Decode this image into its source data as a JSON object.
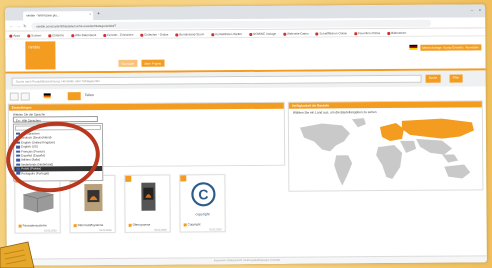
{
  "colors": {
    "accent": "#f39c1f",
    "annotation": "#b7371f",
    "background": "#f4cf7c"
  },
  "browser": {
    "tab_title": "nimble - Wohnzone plu...",
    "tab_close": "×",
    "new_tab": "+",
    "minimize": "–",
    "close": "×",
    "url": "nimble.com/content/bauteile/suche-erweitert/kategorie/bild/7",
    "back": "←",
    "forward": "→",
    "reload": "↻",
    "bookmarks": [
      "Apps",
      "Suchen",
      "Einfache",
      "Wiki-Datenbank",
      "Fenster - Einrichten",
      "Einfacher - Online",
      "Bundesland-Sturm",
      "Kontaktlisten Wetter",
      "NOMINE Vorlage",
      "Webseite-Daten",
      "Schaltflächen Online",
      "Favoriten-Online",
      "Bildmarken"
    ]
  },
  "app": {
    "logo": "nimble",
    "top_buttons": [
      "Meine Anfragen",
      "Konto-Einstellungen",
      "Abmelden"
    ],
    "nav_tabs": [
      "Startseite",
      "Mein Projekt"
    ],
    "search_placeholder": "Suche nach Produktbezeichnung, Hersteller oder Schlagworten",
    "search_button": "Suche",
    "filter_button": "Filter",
    "share_label": "Teilen",
    "left_panel_title": "Einstellungen",
    "select_label": "Wählen Sie die Sprache",
    "select_value": "En - Alle Sprachen",
    "dropdown_items": [
      "Alle Sprachen",
      "Deutsch (Deutschland)",
      "English (United Kingdom)",
      "English (US)",
      "Français (France)",
      "Español (España)",
      "Italiano (Italia)",
      "Nederlands (Nederland)",
      "Polski (Polska)",
      "Português (Portugal)"
    ],
    "dropdown_selected": 8,
    "map_panel_title": "Verfügbarkeit der Bauteile",
    "map_subtitle": "Wählen Sie ein Land aus, um die Bauteilangaben zu sehen",
    "products": [
      {
        "label": "Fassadensysteme",
        "date": "01.02.2019",
        "image": "block-icon"
      },
      {
        "label": "Dämmstoffsysteme",
        "date": "01.02.2019",
        "image": "stove-icon"
      },
      {
        "label": "Ofensysteme",
        "date": "01.02.2019",
        "image": "oven-icon"
      },
      {
        "label": "Copyright",
        "date": "01.02.2019",
        "image": "copyright-icon",
        "img_text": "copyright"
      }
    ],
    "footer": "Impressum | Datenschutz | Nutzungsbedingungen | Kontakt"
  }
}
